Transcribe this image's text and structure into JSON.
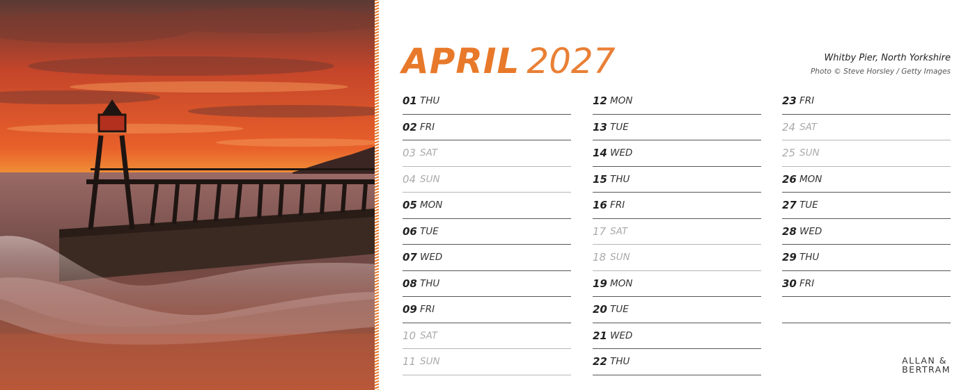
{
  "calendar": {
    "month_name": "APRIL",
    "year": "2027",
    "accent_color": "#e8792a",
    "photo": {
      "subject": "lighthouse pier at sunset",
      "caption_place": "Whitby Pier, North Yorkshire",
      "caption_credit": "Photo © Steve Horsley / Getty Images"
    },
    "columns": [
      [
        {
          "num": "01",
          "day": "THU",
          "weekend": false
        },
        {
          "num": "02",
          "day": "FRI",
          "weekend": false
        },
        {
          "num": "03",
          "day": "SAT",
          "weekend": true
        },
        {
          "num": "04",
          "day": "SUN",
          "weekend": true
        },
        {
          "num": "05",
          "day": "MON",
          "weekend": false
        },
        {
          "num": "06",
          "day": "TUE",
          "weekend": false
        },
        {
          "num": "07",
          "day": "WED",
          "weekend": false
        },
        {
          "num": "08",
          "day": "THU",
          "weekend": false
        },
        {
          "num": "09",
          "day": "FRI",
          "weekend": false
        },
        {
          "num": "10",
          "day": "SAT",
          "weekend": true
        },
        {
          "num": "11",
          "day": "SUN",
          "weekend": true
        }
      ],
      [
        {
          "num": "12",
          "day": "MON",
          "weekend": false
        },
        {
          "num": "13",
          "day": "TUE",
          "weekend": false
        },
        {
          "num": "14",
          "day": "WED",
          "weekend": false
        },
        {
          "num": "15",
          "day": "THU",
          "weekend": false
        },
        {
          "num": "16",
          "day": "FRI",
          "weekend": false
        },
        {
          "num": "17",
          "day": "SAT",
          "weekend": true
        },
        {
          "num": "18",
          "day": "SUN",
          "weekend": true
        },
        {
          "num": "19",
          "day": "MON",
          "weekend": false
        },
        {
          "num": "20",
          "day": "TUE",
          "weekend": false
        },
        {
          "num": "21",
          "day": "WED",
          "weekend": false
        },
        {
          "num": "22",
          "day": "THU",
          "weekend": false
        }
      ],
      [
        {
          "num": "23",
          "day": "FRI",
          "weekend": false
        },
        {
          "num": "24",
          "day": "SAT",
          "weekend": true
        },
        {
          "num": "25",
          "day": "SUN",
          "weekend": true
        },
        {
          "num": "26",
          "day": "MON",
          "weekend": false
        },
        {
          "num": "27",
          "day": "TUE",
          "weekend": false
        },
        {
          "num": "28",
          "day": "WED",
          "weekend": false
        },
        {
          "num": "29",
          "day": "THU",
          "weekend": false
        },
        {
          "num": "30",
          "day": "FRI",
          "weekend": false
        }
      ]
    ],
    "publisher": {
      "line1": "ALLAN &",
      "line2": "BERTRAM"
    }
  }
}
